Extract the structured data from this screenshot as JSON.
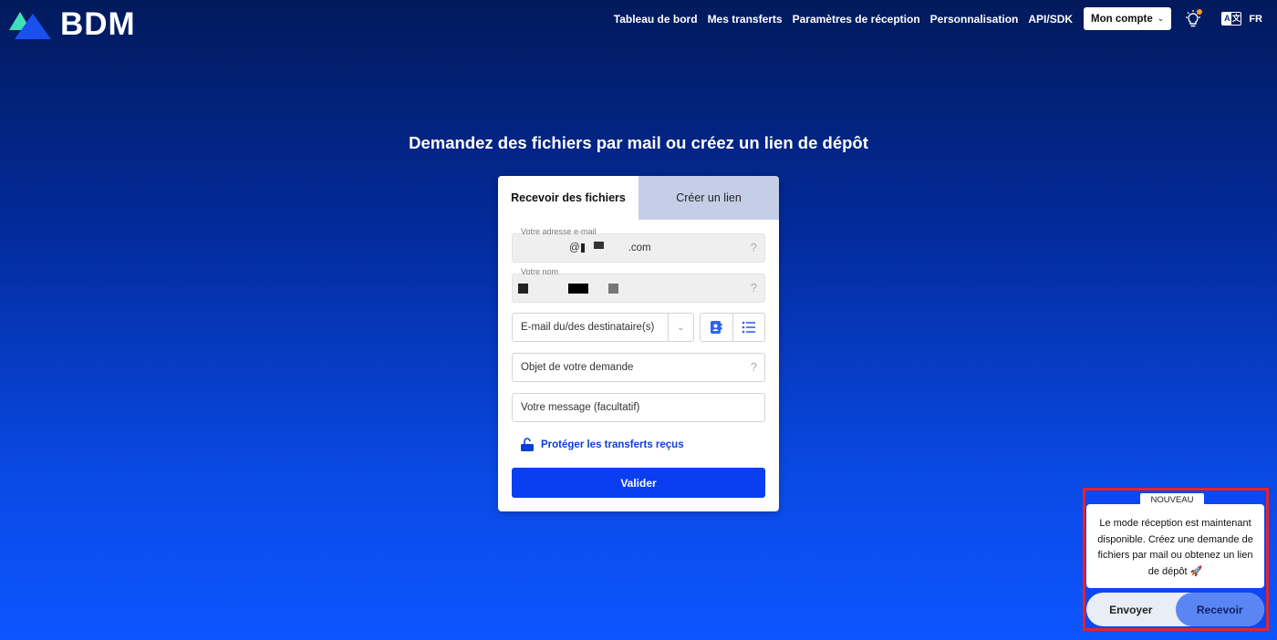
{
  "brand": {
    "name": "BDM"
  },
  "nav": {
    "links": [
      "Tableau de bord",
      "Mes transferts",
      "Paramètres de réception",
      "Personnalisation",
      "API/SDK"
    ],
    "account": "Mon compte",
    "language": "FR",
    "language_icon": {
      "left": "A",
      "right": "文"
    }
  },
  "page": {
    "title": "Demandez des fichiers par mail ou créez un lien de dépôt"
  },
  "tabs": {
    "receive": "Recevoir des fichiers",
    "link": "Créer un lien"
  },
  "form": {
    "email": {
      "label": "Votre adresse e-mail",
      "value_at": "@",
      "value_domain": ".com",
      "help": "?"
    },
    "name": {
      "label": "Votre nom",
      "help": "?"
    },
    "recipients": {
      "placeholder": "E-mail du/des destinataire(s)"
    },
    "subject": {
      "placeholder": "Objet de votre demande",
      "help": "?"
    },
    "message": {
      "placeholder": "Votre message (facultatif)"
    },
    "protect": "Protéger les transferts reçus",
    "submit": "Valider"
  },
  "promo": {
    "badge": "NOUVEAU",
    "message": "Le mode réception est maintenant disponible. Créez une demande de fichiers par mail ou obtenez un lien de dépôt 🚀",
    "send": "Envoyer",
    "receive": "Recevoir"
  },
  "colors": {
    "accent": "#0a3ef0",
    "highlight_border": "#e8222b"
  }
}
